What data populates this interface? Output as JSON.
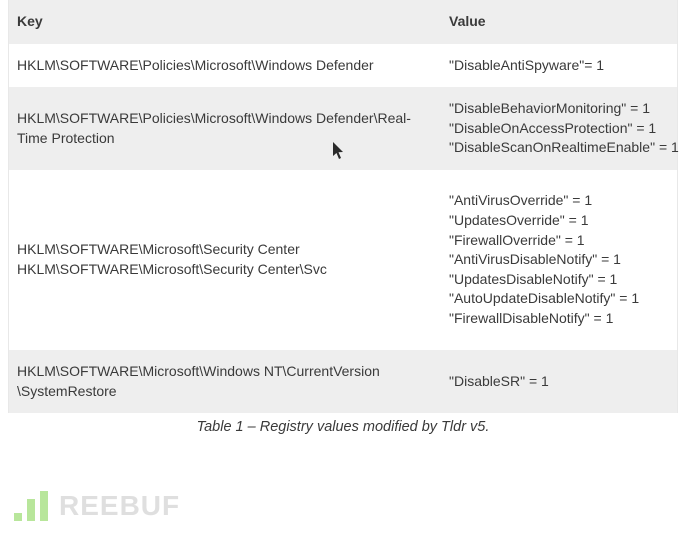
{
  "table": {
    "headers": {
      "key": "Key",
      "value": "Value"
    },
    "rows": [
      {
        "key_lines": [
          "HKLM\\SOFTWARE\\Policies\\Microsoft\\Windows Defender"
        ],
        "value_lines": [
          "\"DisableAntiSpyware\"= 1"
        ]
      },
      {
        "key_lines": [
          "HKLM\\SOFTWARE\\Policies\\Microsoft\\Windows Defender\\Real-",
          "Time Protection"
        ],
        "value_lines": [
          "\"DisableBehaviorMonitoring\" = 1",
          "\"DisableOnAccessProtection\" = 1",
          "\"DisableScanOnRealtimeEnable\" = 1"
        ]
      },
      {
        "key_lines": [
          "HKLM\\SOFTWARE\\Microsoft\\Security Center",
          "HKLM\\SOFTWARE\\Microsoft\\Security Center\\Svc"
        ],
        "value_lines": [
          "\"AntiVirusOverride\" = 1",
          "\"UpdatesOverride\" = 1",
          "\"FirewallOverride\" = 1",
          "\"AntiVirusDisableNotify\" = 1",
          "\"UpdatesDisableNotify\" = 1",
          "\"AutoUpdateDisableNotify\" = 1",
          "\"FirewallDisableNotify\" = 1"
        ]
      },
      {
        "key_lines": [
          "HKLM\\SOFTWARE\\Microsoft\\Windows NT\\CurrentVersion",
          "\\SystemRestore"
        ],
        "value_lines": [
          "\"DisableSR\" = 1"
        ]
      }
    ],
    "caption_prefix": "Table 1 – ",
    "caption_text": "Registry values modified by Tldr v5."
  },
  "watermark_text": "REEBUF"
}
